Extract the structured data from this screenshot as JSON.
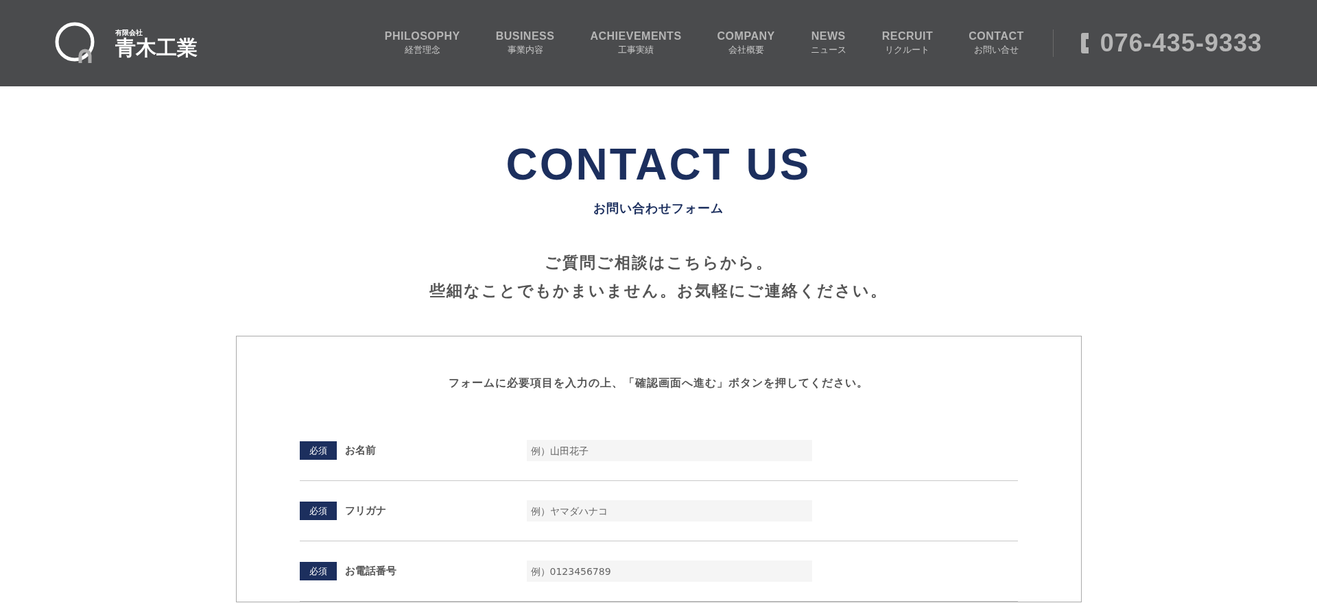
{
  "header": {
    "logo": {
      "small": "有限会社",
      "name": "青木工業"
    },
    "nav": [
      {
        "en": "PHILOSOPHY",
        "ja": "経営理念"
      },
      {
        "en": "BUSINESS",
        "ja": "事業内容"
      },
      {
        "en": "ACHIEVEMENTS",
        "ja": "工事実績"
      },
      {
        "en": "COMPANY",
        "ja": "会社概要"
      },
      {
        "en": "NEWS",
        "ja": "ニュース"
      },
      {
        "en": "RECRUIT",
        "ja": "リクルート"
      },
      {
        "en": "CONTACT",
        "ja": "お問い合せ"
      }
    ],
    "phone": "076-435-9333"
  },
  "title": "CONTACT US",
  "subtitle": "お問い合わせフォーム",
  "intro": [
    "ご質問ご相談はこちらから。",
    "些細なことでもかまいません。お気軽にご連絡ください。"
  ],
  "form": {
    "instruction": "フォームに必要項目を入力の上、「確認画面へ進む」ボタンを押してください。",
    "fields": [
      {
        "badge": "必須",
        "label": "お名前",
        "placeholder": "例）山田花子"
      },
      {
        "badge": "必須",
        "label": "フリガナ",
        "placeholder": "例）ヤマダハナコ"
      },
      {
        "badge": "必須",
        "label": "お電話番号",
        "placeholder": "例）0123456789"
      }
    ]
  }
}
